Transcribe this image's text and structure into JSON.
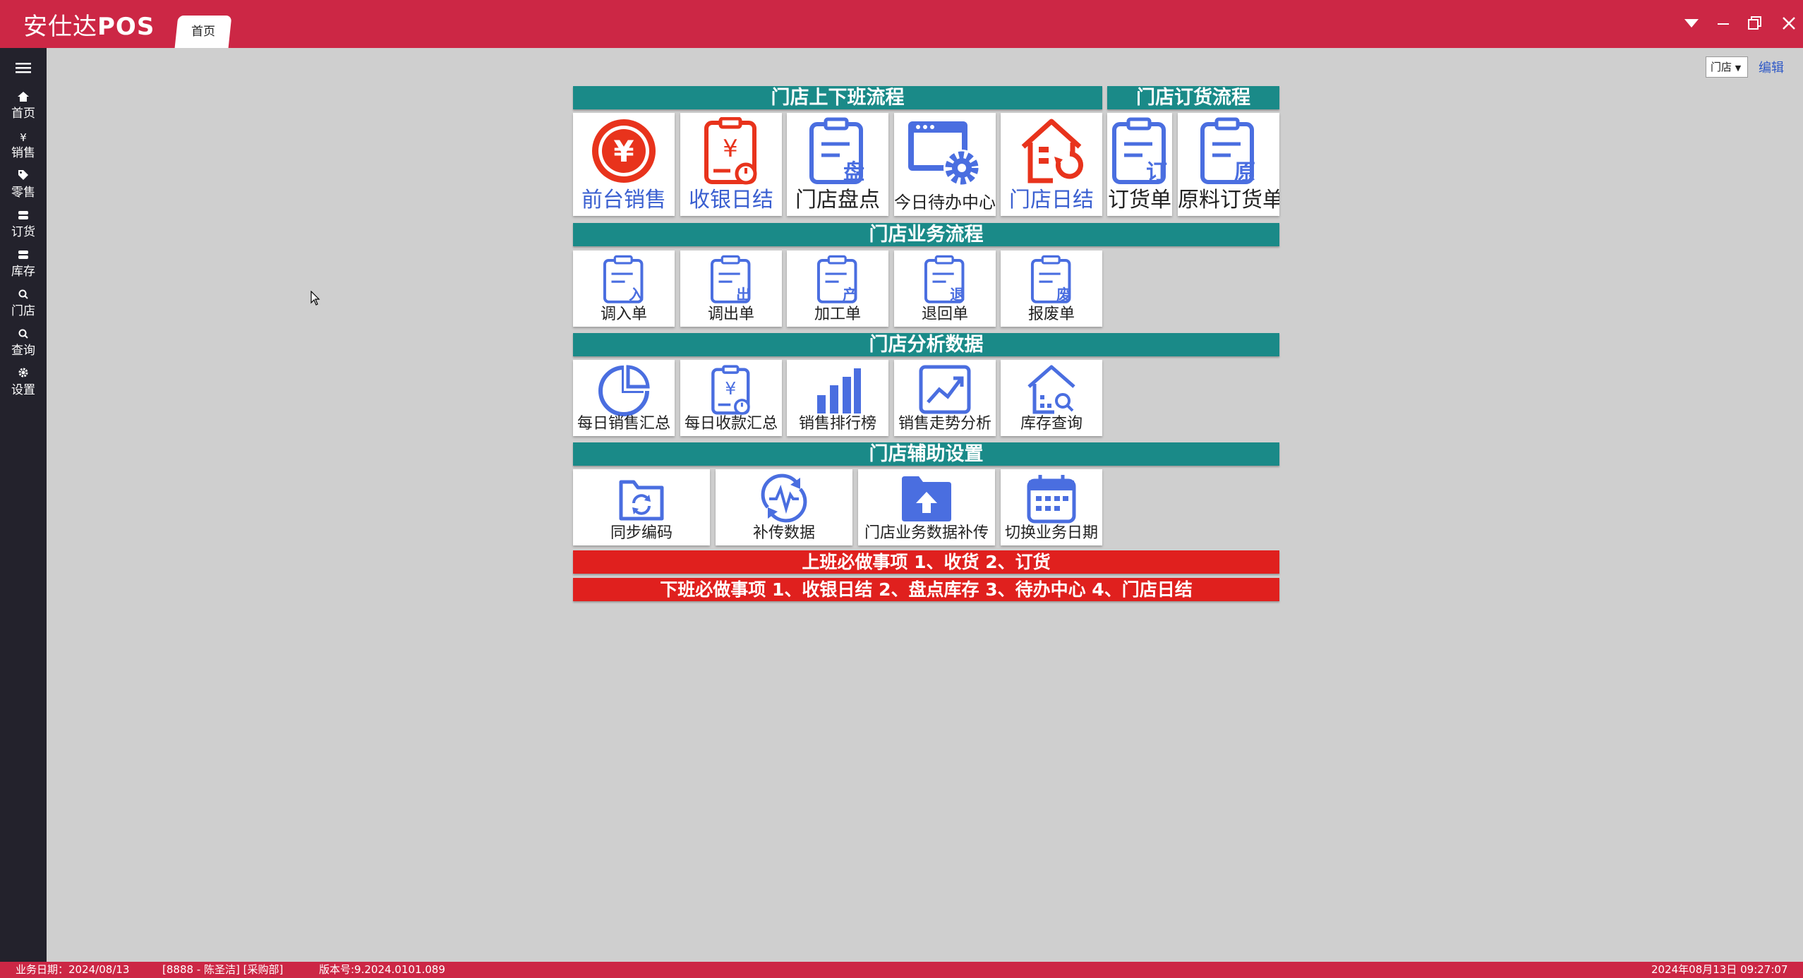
{
  "app": {
    "title_prefix": "安仕达",
    "title_suffix": "POS"
  },
  "tabs": [
    {
      "label": "首页"
    }
  ],
  "window_controls": {
    "dropdown": "dropdown-icon",
    "minimize": "minimize-icon",
    "restore": "restore-icon",
    "close": "close-icon"
  },
  "sidebar": {
    "menu_icon": "hamburger-icon",
    "items": [
      {
        "label": "首页",
        "icon": "home-icon"
      },
      {
        "label": "销售",
        "icon": "yen-icon"
      },
      {
        "label": "零售",
        "icon": "tag-icon"
      },
      {
        "label": "订货",
        "icon": "db-icon"
      },
      {
        "label": "库存",
        "icon": "db-icon"
      },
      {
        "label": "门店",
        "icon": "search-icon"
      },
      {
        "label": "查询",
        "icon": "search-icon"
      },
      {
        "label": "设置",
        "icon": "gear-icon"
      }
    ]
  },
  "toolbar": {
    "store_select_value": "门店",
    "edit_label": "编辑"
  },
  "sections": {
    "shift_flow": "门店上下班流程",
    "order_flow": "门店订货流程",
    "business_flow": "门店业务流程",
    "analysis": "门店分析数据",
    "aux_settings": "门店辅助设置"
  },
  "tiles": {
    "front_sales": "前台销售",
    "cash_daily": "收银日结",
    "store_stocktake": "门店盘点",
    "todo_center": "今日待办中心",
    "store_daily": "门店日结",
    "order_form": "订货单",
    "raw_order_form": "原料订货单",
    "transfer_in": "调入单",
    "transfer_out": "调出单",
    "processing": "加工单",
    "return_form": "退回单",
    "scrap_form": "报废单",
    "daily_sales_summary": "每日销售汇总",
    "daily_receipt_summary": "每日收款汇总",
    "sales_ranking": "销售排行榜",
    "sales_trend": "销售走势分析",
    "inventory_query": "库存查询",
    "sync_codes": "同步编码",
    "resend_data": "补传数据",
    "store_data_resend": "门店业务数据补传",
    "switch_business_date": "切换业务日期"
  },
  "tile_badges": {
    "stocktake": "盘",
    "order": "订",
    "raw": "原",
    "in": "入",
    "out": "出",
    "produce": "产",
    "return": "退",
    "scrap": "废",
    "yen": "¥"
  },
  "reminders": {
    "start_shift": "上班必做事项 1、收货 2、订货",
    "end_shift": "下班必做事项 1、收银日结 2、盘点库存 3、待办中心 4、门店日结"
  },
  "status": {
    "business_date": "业务日期：2024/08/13",
    "user": "[8888 - 陈圣洁]  [采购部]",
    "version": "版本号:9.2024.0101.089",
    "datetime": "2024年08月13日 09:27:07"
  },
  "colors": {
    "brand": "#cc2745",
    "section": "#1a8a88",
    "reminder": "#e0201e",
    "icon_blue": "#4a6ee0",
    "icon_red": "#e8331c"
  }
}
